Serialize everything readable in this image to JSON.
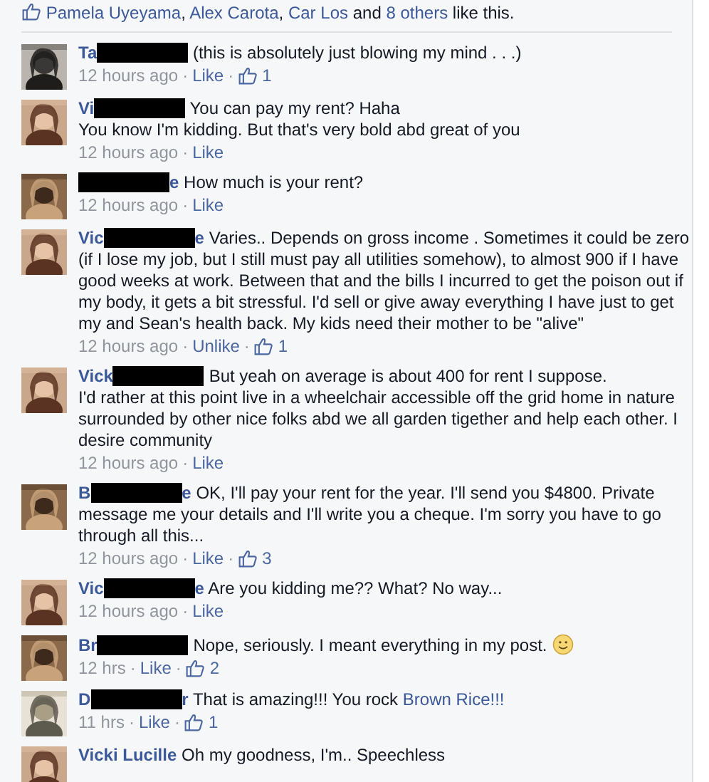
{
  "likes_summary": [
    {
      "kind": "link",
      "text": "Pamela Uyeyama"
    },
    {
      "kind": "text",
      "text": ","
    },
    {
      "kind": "link",
      "text": "Alex Carota"
    },
    {
      "kind": "text",
      "text": ","
    },
    {
      "kind": "link",
      "text": "Car Los"
    },
    {
      "kind": "text",
      "text": "and"
    },
    {
      "kind": "link",
      "text": "8 others"
    },
    {
      "kind": "text",
      "text": "like this."
    }
  ],
  "comments": [
    {
      "name_start": "Ta",
      "parts": [
        {
          "kind": "text",
          "text": "(this is absolutely just blowing my mind . . .)"
        }
      ],
      "meta": [
        {
          "kind": "time",
          "text": "12 hours ago"
        },
        {
          "kind": "sep",
          "text": "·"
        },
        {
          "kind": "action",
          "text": "Like"
        },
        {
          "kind": "sep",
          "text": "·"
        },
        {
          "kind": "likes",
          "text": "1"
        }
      ]
    },
    {
      "name_start": "Vi",
      "parts": [
        {
          "kind": "text",
          "text": "You can pay my rent? Haha"
        },
        {
          "kind": "break"
        },
        {
          "kind": "text",
          "text": "You know I'm kidding. But that's very bold abd great of you"
        }
      ],
      "meta": [
        {
          "kind": "time",
          "text": "12 hours ago"
        },
        {
          "kind": "sep",
          "text": "·"
        },
        {
          "kind": "action",
          "text": "Like"
        }
      ]
    },
    {
      "name_end": "e",
      "parts": [
        {
          "kind": "text",
          "text": "How much is your rent?"
        }
      ],
      "meta": [
        {
          "kind": "time",
          "text": "12 hours ago"
        },
        {
          "kind": "sep",
          "text": "·"
        },
        {
          "kind": "action",
          "text": "Like"
        }
      ]
    },
    {
      "name_start": "Vic",
      "name_end": "e",
      "parts": [
        {
          "kind": "text",
          "text": "Varies.. Depends on gross income . Sometimes it could be zero (if I lose my job, but I still must pay all utilities somehow), to almost 900 if I have good weeks at work. Between that and the bills I incurred to get the poison out if my body, it gets a bit stressful. I'd sell or give away everything I have just to get my and Sean's health back. My kids need their mother to be \"alive\""
        }
      ],
      "meta": [
        {
          "kind": "time",
          "text": "12 hours ago"
        },
        {
          "kind": "sep",
          "text": "·"
        },
        {
          "kind": "action",
          "text": "Unlike"
        },
        {
          "kind": "sep",
          "text": "·"
        },
        {
          "kind": "likes",
          "text": "1"
        }
      ]
    },
    {
      "name_start": "Vick",
      "parts": [
        {
          "kind": "text",
          "text": "But yeah on average is about 400 for rent I suppose."
        },
        {
          "kind": "break"
        },
        {
          "kind": "text",
          "text": "I'd rather at this point live in a wheelchair accessible off the grid home in nature surrounded by other nice folks abd we all garden tigether and help each other. I desire community"
        }
      ],
      "meta": [
        {
          "kind": "time",
          "text": "12 hours ago"
        },
        {
          "kind": "sep",
          "text": "·"
        },
        {
          "kind": "action",
          "text": "Like"
        }
      ]
    },
    {
      "name_start": "B",
      "name_end": "e",
      "parts": [
        {
          "kind": "text",
          "text": "OK, I'll pay your rent for the year. I'll send you $4800. Private message me your details and I'll write you a cheque. I'm sorry you have to go through all this..."
        }
      ],
      "meta": [
        {
          "kind": "time",
          "text": "12 hours ago"
        },
        {
          "kind": "sep",
          "text": "·"
        },
        {
          "kind": "action",
          "text": "Like"
        },
        {
          "kind": "sep",
          "text": "·"
        },
        {
          "kind": "likes",
          "text": "3"
        }
      ]
    },
    {
      "name_start": "Vic",
      "name_end": "e",
      "parts": [
        {
          "kind": "text",
          "text": "Are you kidding me?? What? No way..."
        }
      ],
      "meta": [
        {
          "kind": "time",
          "text": "12 hours ago"
        },
        {
          "kind": "sep",
          "text": "·"
        },
        {
          "kind": "action",
          "text": "Like"
        }
      ]
    },
    {
      "name_start": "Br",
      "parts": [
        {
          "kind": "text",
          "text": "Nope, seriously. I meant everything in my post."
        },
        {
          "kind": "emoji"
        }
      ],
      "meta": [
        {
          "kind": "time",
          "text": "12 hrs"
        },
        {
          "kind": "sep",
          "text": "·"
        },
        {
          "kind": "action",
          "text": "Like"
        },
        {
          "kind": "sep",
          "text": "·"
        },
        {
          "kind": "likes",
          "text": "2"
        }
      ]
    },
    {
      "name_start": "D",
      "name_end": "r",
      "parts": [
        {
          "kind": "text",
          "text": "That is amazing!!! You rock"
        },
        {
          "kind": "link",
          "text": "Brown Rice!!!"
        }
      ],
      "meta": [
        {
          "kind": "time",
          "text": "11 hrs"
        },
        {
          "kind": "sep",
          "text": "·"
        },
        {
          "kind": "action",
          "text": "Like"
        },
        {
          "kind": "sep",
          "text": "·"
        },
        {
          "kind": "likes",
          "text": "1"
        }
      ]
    },
    {
      "name_start": "Vicki Lucille",
      "plain_name": true,
      "parts": [
        {
          "kind": "text",
          "text": "Oh my goodness, I'm.. Speechless"
        }
      ]
    }
  ]
}
